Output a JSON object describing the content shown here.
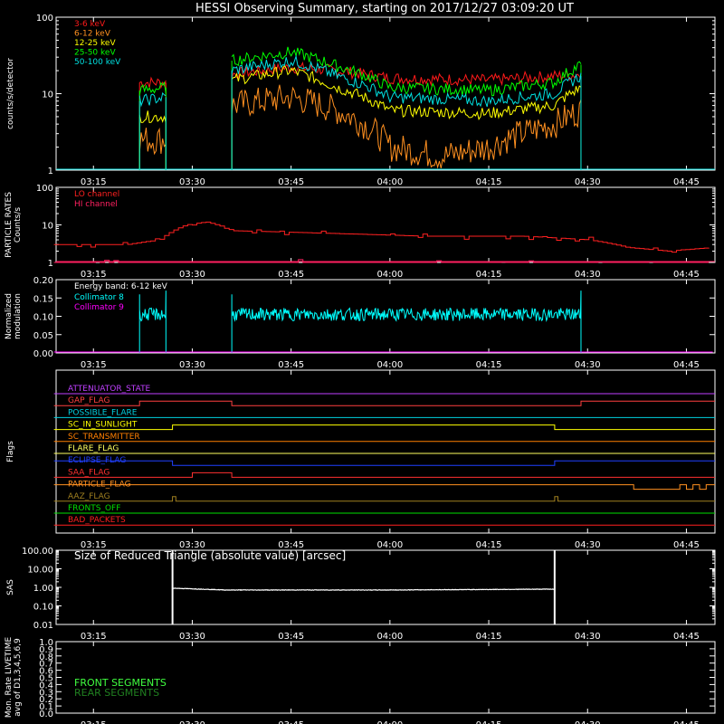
{
  "title": "HESSI Observing Summary, starting on 2017/12/27 03:09:20 UT",
  "time_ticks": [
    "03:15",
    "03:30",
    "03:45",
    "04:00",
    "04:15",
    "04:30",
    "04:45"
  ],
  "time_range": [
    "03:09:20",
    "04:49:20"
  ],
  "chart_data": [
    {
      "id": "xray",
      "type": "line",
      "ylabel": "counts/s/detector",
      "yscale": "log",
      "ylim": [
        1,
        100
      ],
      "yticks": [
        "1",
        "10",
        "100"
      ],
      "legend": "top-left",
      "series": [
        {
          "name": "3-6 keV",
          "color": "#ff1a1a",
          "points": [
            [
              "03:22",
              14
            ],
            [
              "03:26",
              14
            ],
            [
              "03:36",
              18
            ],
            [
              "03:45",
              22
            ],
            [
              "03:52",
              20
            ],
            [
              "04:00",
              16
            ],
            [
              "04:15",
              15
            ],
            [
              "04:25",
              17
            ],
            [
              "04:29",
              18
            ]
          ]
        },
        {
          "name": "6-12 keV",
          "color": "#ff9020",
          "points": [
            [
              "03:22",
              2.5
            ],
            [
              "03:26",
              2.5
            ],
            [
              "03:36",
              7
            ],
            [
              "03:45",
              9
            ],
            [
              "03:52",
              6
            ],
            [
              "04:00",
              2
            ],
            [
              "04:08",
              1.5
            ],
            [
              "04:15",
              2
            ],
            [
              "04:25",
              4
            ],
            [
              "04:29",
              6
            ]
          ]
        },
        {
          "name": "12-25 keV",
          "color": "#ffff00",
          "points": [
            [
              "03:22",
              5
            ],
            [
              "03:26",
              5
            ],
            [
              "03:36",
              15
            ],
            [
              "03:45",
              20
            ],
            [
              "03:52",
              12
            ],
            [
              "04:00",
              6
            ],
            [
              "04:15",
              5.5
            ],
            [
              "04:25",
              7
            ],
            [
              "04:29",
              12
            ]
          ]
        },
        {
          "name": "25-50 keV",
          "color": "#00ff00",
          "points": [
            [
              "03:22",
              11
            ],
            [
              "03:26",
              12
            ],
            [
              "03:36",
              27
            ],
            [
              "03:45",
              35
            ],
            [
              "03:52",
              23
            ],
            [
              "04:00",
              12
            ],
            [
              "04:15",
              11
            ],
            [
              "04:25",
              14
            ],
            [
              "04:29",
              24
            ]
          ]
        },
        {
          "name": "50-100 keV",
          "color": "#00e0e0",
          "points": [
            [
              "03:22",
              8
            ],
            [
              "03:26",
              9
            ],
            [
              "03:36",
              20
            ],
            [
              "03:45",
              27
            ],
            [
              "03:52",
              17
            ],
            [
              "04:00",
              9
            ],
            [
              "04:15",
              8
            ],
            [
              "04:25",
              10
            ],
            [
              "04:29",
              17
            ]
          ]
        }
      ]
    },
    {
      "id": "particle",
      "type": "line",
      "ylabel": "PARTICLE RATES Counts/s",
      "yscale": "log",
      "ylim": [
        1,
        100
      ],
      "yticks": [
        "1",
        "10",
        "100"
      ],
      "legend": "top-left",
      "series": [
        {
          "name": "LO channel",
          "color": "#ff2020",
          "points": [
            [
              "03:09",
              3
            ],
            [
              "03:20",
              3
            ],
            [
              "03:25",
              4
            ],
            [
              "03:29",
              10
            ],
            [
              "03:32",
              12
            ],
            [
              "03:36",
              7
            ],
            [
              "03:50",
              6
            ],
            [
              "04:05",
              5
            ],
            [
              "04:20",
              5
            ],
            [
              "04:30",
              4
            ],
            [
              "04:36",
              2.5
            ],
            [
              "04:42",
              2
            ],
            [
              "04:49",
              2.5
            ]
          ]
        },
        {
          "name": "HI channel",
          "color": "#ff2060",
          "points": [
            [
              "03:09",
              1
            ],
            [
              "04:49",
              1
            ]
          ]
        }
      ]
    },
    {
      "id": "modulation",
      "type": "line",
      "ylabel": "Normalized modulation",
      "ylim": [
        0,
        0.2
      ],
      "yticks": [
        "0.00",
        "0.05",
        "0.10",
        "0.15",
        "0.20"
      ],
      "legend": "top-left",
      "legend_title": "Energy band: 6-12 keV",
      "series": [
        {
          "name": "Collimator 8",
          "color": "#00ffff",
          "level": 0.105,
          "segments": [
            [
              "03:22",
              "03:26"
            ],
            [
              "03:36",
              "04:29"
            ]
          ]
        },
        {
          "name": "Collimator 9",
          "color": "#ff00ff",
          "level": 0.0,
          "segments": [
            [
              "03:09",
              "04:49"
            ]
          ]
        }
      ]
    },
    {
      "id": "flags",
      "type": "line",
      "ylabel": "Flags",
      "series": [
        {
          "name": "ATTENUATOR_STATE",
          "color": "#c040ff",
          "states": [
            [
              "03:09",
              0
            ]
          ]
        },
        {
          "name": "GAP_FLAG",
          "color": "#ff4040",
          "states": [
            [
              "03:09",
              0
            ],
            [
              "03:22",
              1
            ],
            [
              "03:36",
              0
            ],
            [
              "04:29",
              1
            ]
          ]
        },
        {
          "name": "POSSIBLE_FLARE",
          "color": "#00d0e0",
          "states": [
            [
              "03:09",
              0
            ]
          ]
        },
        {
          "name": "SC_IN_SUNLIGHT",
          "color": "#ffff00",
          "states": [
            [
              "03:09",
              0
            ],
            [
              "03:27",
              1
            ],
            [
              "04:25",
              0
            ]
          ]
        },
        {
          "name": "SC_TRANSMITTER",
          "color": "#ff8000",
          "states": [
            [
              "03:09",
              0
            ]
          ]
        },
        {
          "name": "FLARE_FLAG",
          "color": "#ffff60",
          "states": [
            [
              "03:09",
              0
            ]
          ]
        },
        {
          "name": "ECLIPSE_FLAG",
          "color": "#2040ff",
          "states": [
            [
              "03:09",
              1
            ],
            [
              "03:27",
              0
            ],
            [
              "04:25",
              1
            ]
          ]
        },
        {
          "name": "SAA_FLAG",
          "color": "#ff3030",
          "states": [
            [
              "03:09",
              0
            ],
            [
              "03:30",
              1
            ],
            [
              "03:36",
              0
            ]
          ]
        },
        {
          "name": "PARTICLE_FLAG",
          "color": "#ff9020",
          "states": [
            [
              "03:09",
              1
            ],
            [
              "04:37",
              0
            ],
            [
              "04:44",
              1
            ],
            [
              "04:45",
              0
            ],
            [
              "04:46",
              1
            ],
            [
              "04:47",
              0
            ],
            [
              "04:48",
              1
            ]
          ]
        },
        {
          "name": "AAZ_FLAG",
          "color": "#a08020",
          "states": [
            [
              "03:09",
              0
            ],
            [
              "03:27",
              1
            ],
            [
              "03:27:30",
              0
            ],
            [
              "04:25",
              1
            ],
            [
              "04:25:30",
              0
            ]
          ]
        },
        {
          "name": "FRONTS_OFF",
          "color": "#00e000",
          "states": [
            [
              "03:09",
              0
            ]
          ]
        },
        {
          "name": "BAD_PACKETS",
          "color": "#ff2020",
          "states": [
            [
              "03:09",
              0
            ]
          ]
        }
      ]
    },
    {
      "id": "sas",
      "type": "line",
      "ylabel": "SAS",
      "yscale": "log",
      "ylim": [
        0.01,
        100
      ],
      "yticks": [
        "0.01",
        "0.10",
        "1.00",
        "10.00",
        "100.00"
      ],
      "legend": "top-left",
      "series": [
        {
          "name": "Size of Reduced Triangle (absolute value) [arcsec]",
          "color": "#ffffff",
          "points": [
            [
              "03:27",
              0.9
            ],
            [
              "03:35",
              0.72
            ],
            [
              "04:00",
              0.72
            ],
            [
              "04:25",
              0.8
            ]
          ]
        }
      ]
    },
    {
      "id": "livetime",
      "type": "line",
      "ylabel": "Mon. Rate LIVETIME avg of D1,3,4,5,6,9",
      "ylim": [
        0,
        1
      ],
      "yticks": [
        "0.0",
        "0.1",
        "0.2",
        "0.3",
        "0.4",
        "0.5",
        "0.6",
        "0.7",
        "0.8",
        "0.9",
        "1.0"
      ],
      "legend": "bottom-left",
      "series": [
        {
          "name": "FRONT SEGMENTS",
          "color": "#40ff40",
          "points": []
        },
        {
          "name": "REAR SEGMENTS",
          "color": "#208020",
          "points": []
        }
      ]
    }
  ]
}
